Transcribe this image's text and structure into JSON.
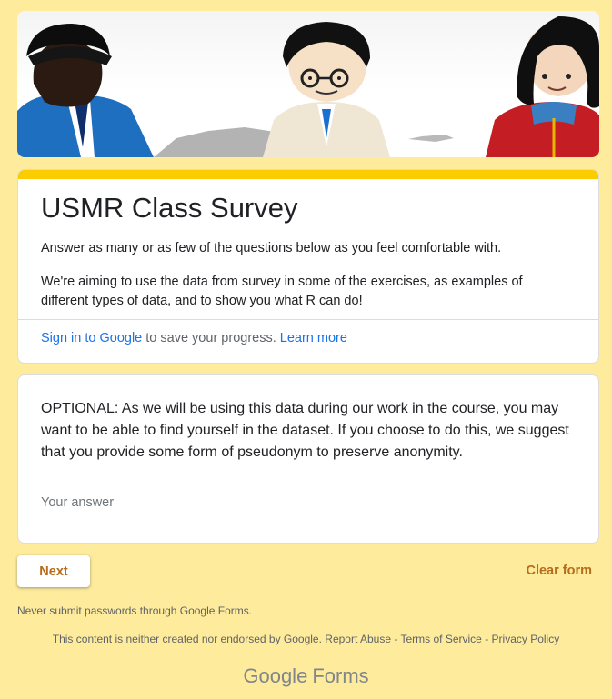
{
  "form": {
    "title": "USMR Class Survey",
    "description_1": "Answer as many or as few of the questions below as you feel comfortable with.",
    "description_2": "We're aiming to use the data from survey in some of the exercises, as examples of different types of data, and to show you what R can do!",
    "signin_link": "Sign in to Google",
    "signin_text": "to save your progress.",
    "learn_more": "Learn more"
  },
  "question": {
    "text": "OPTIONAL: As we will be using this data during our work in the course, you may want to be able to find yourself in the dataset. If you choose to do this, we suggest that you provide some form of pseudonym to preserve anonymity.",
    "value": "",
    "placeholder": "Your answer"
  },
  "actions": {
    "next_label": "Next",
    "clear_label": "Clear form"
  },
  "footer": {
    "never_submit": "Never submit passwords through Google Forms.",
    "disclaimer": "This content is neither created nor endorsed by Google.",
    "report_abuse": "Report Abuse",
    "terms": "Terms of Service",
    "privacy": "Privacy Policy",
    "separator": "-",
    "brand_google": "Google",
    "brand_forms": "Forms"
  },
  "theme": {
    "background": "#feeb9c",
    "accent_bar": "#fbcd00",
    "button_text": "#b66c1a",
    "link": "#1a73e8"
  },
  "icons": {
    "header": "header-image"
  }
}
